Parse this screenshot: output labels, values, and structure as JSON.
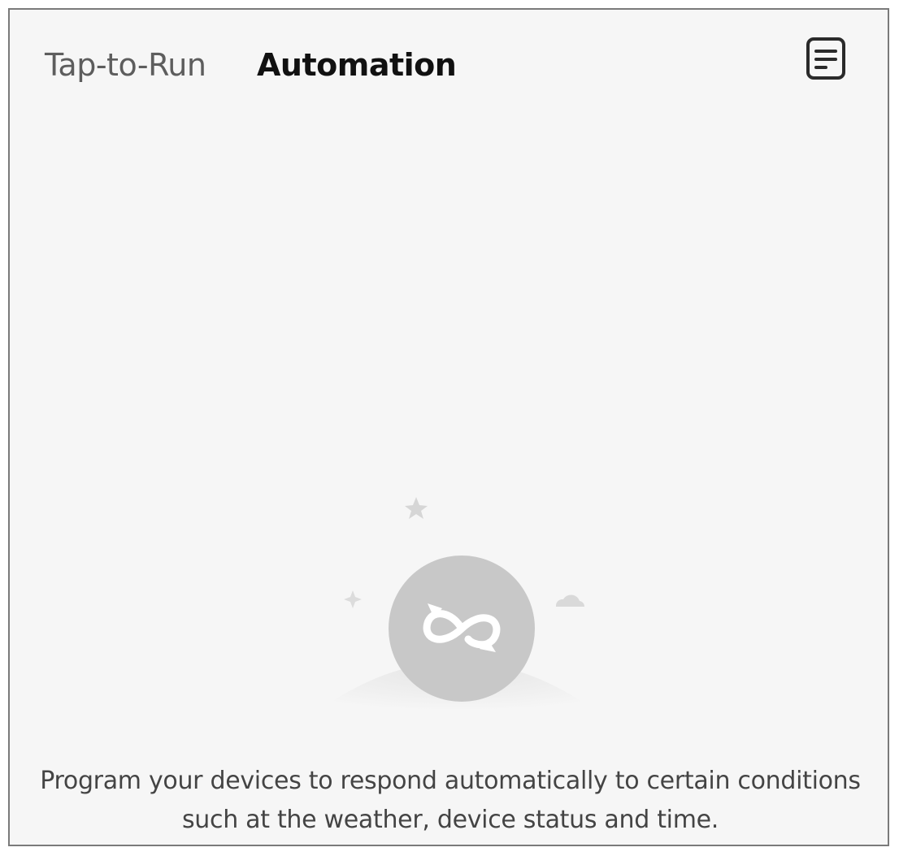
{
  "tabs": {
    "tap_to_run": "Tap-to-Run",
    "automation": "Automation"
  },
  "toolbar": {
    "log_icon": "document-list-icon"
  },
  "empty_state": {
    "illustration_icon": "automation-loop-icon",
    "message_line1": "Program your devices to respond automatically to certain conditions",
    "message_line2": "such at the weather, device status and time."
  },
  "colors": {
    "background": "#f6f6f6",
    "active_tab": "#111111",
    "inactive_tab": "#5d5d5d",
    "illustration_circle": "#c8c8c8",
    "message_text": "#444444"
  }
}
